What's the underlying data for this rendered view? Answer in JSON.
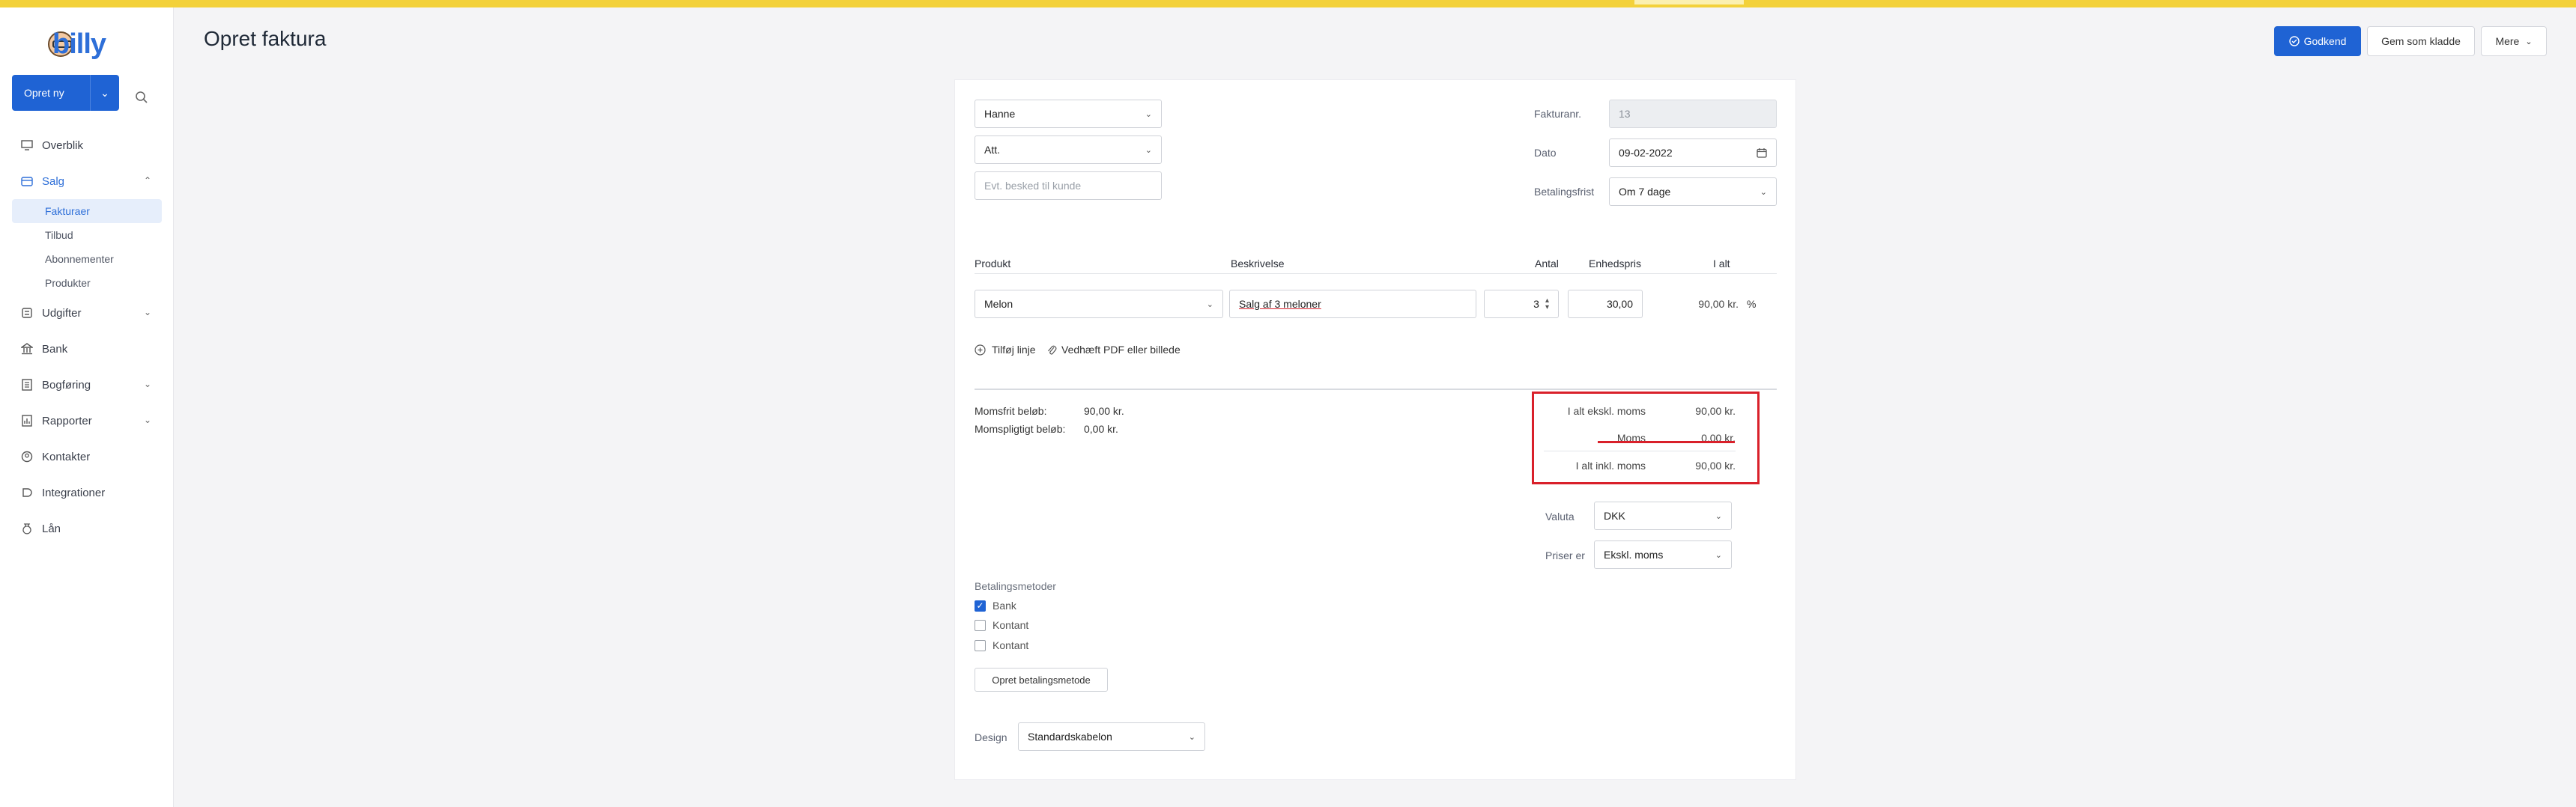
{
  "app": {
    "logo_text": "billy"
  },
  "sidebar": {
    "create_label": "Opret ny",
    "items": [
      {
        "label": "Overblik",
        "icon": "monitor-icon"
      },
      {
        "label": "Salg",
        "icon": "sales-icon"
      },
      {
        "label": "Udgifter",
        "icon": "expenses-icon"
      },
      {
        "label": "Bank",
        "icon": "bank-icon"
      },
      {
        "label": "Bogføring",
        "icon": "ledger-icon"
      },
      {
        "label": "Rapporter",
        "icon": "reports-icon"
      },
      {
        "label": "Kontakter",
        "icon": "contacts-icon"
      },
      {
        "label": "Integrationer",
        "icon": "integrations-icon"
      },
      {
        "label": "Lån",
        "icon": "loan-icon"
      }
    ],
    "salg_sub": [
      "Fakturaer",
      "Tilbud",
      "Abonnementer",
      "Produkter"
    ]
  },
  "header": {
    "title": "Opret faktura",
    "approve_label": "Godkend",
    "draft_label": "Gem som kladde",
    "more_label": "Mere"
  },
  "invoice": {
    "customer": "Hanne",
    "att": "Att.",
    "message_placeholder": "Evt. besked til kunde",
    "invoice_no_label": "Fakturanr.",
    "invoice_no": "13",
    "date_label": "Dato",
    "date": "09-02-2022",
    "terms_label": "Betalingsfrist",
    "terms": "Om 7 dage"
  },
  "lines": {
    "headers": {
      "product": "Produkt",
      "description": "Beskrivelse",
      "qty": "Antal",
      "unit_price": "Enhedspris",
      "total": "I alt"
    },
    "rows": [
      {
        "product": "Melon",
        "description": "Salg af 3 meloner",
        "qty": "3",
        "unit_price": "30,00",
        "total": "90,00 kr.",
        "percent": "%"
      }
    ],
    "add_line": "Tilføj linje",
    "attach": "Vedhæft PDF eller billede"
  },
  "summary": {
    "vat_free_label": "Momsfrit beløb:",
    "vat_free": "90,00 kr.",
    "vat_liable_label": "Momspligtigt beløb:",
    "vat_liable": "0,00 kr.",
    "excl_label": "I alt ekskl. moms",
    "excl": "90,00 kr.",
    "vat_label": "Moms",
    "vat": "0,00 kr.",
    "incl_label": "I alt inkl. moms",
    "incl": "90,00 kr."
  },
  "currency": {
    "label": "Valuta",
    "value": "DKK"
  },
  "prices": {
    "label": "Priser er",
    "value": "Ekskl. moms"
  },
  "payment": {
    "title": "Betalingsmetoder",
    "methods": [
      {
        "label": "Bank",
        "checked": true
      },
      {
        "label": "Kontant",
        "checked": false
      },
      {
        "label": "Kontant",
        "checked": false
      }
    ],
    "create_label": "Opret betalingsmetode"
  },
  "design": {
    "label": "Design",
    "value": "Standardskabelon"
  },
  "colors": {
    "accent": "#1f63d4",
    "highlight": "#d9202a",
    "topbar": "#f3d13a"
  }
}
